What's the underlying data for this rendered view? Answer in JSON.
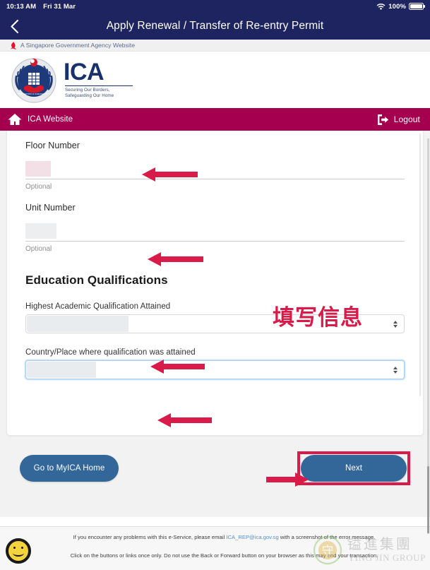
{
  "status_bar": {
    "time": "10:13 AM",
    "date": "Fri 31 Mar",
    "battery_percent": "100%",
    "wifi_icon": "wifi-icon",
    "battery_icon": "battery-full-icon"
  },
  "app_bar": {
    "back_icon": "chevron-left-icon",
    "title": "Apply Renewal / Transfer of Re-entry Permit"
  },
  "gov_banner": {
    "flag_icon": "singapore-flag-icon",
    "text": "A Singapore Government Agency Website"
  },
  "branding": {
    "crest_icon": "ica-crest-icon",
    "acronym": "ICA",
    "tagline_line1": "Securing Our Borders,",
    "tagline_line2": "Safeguarding Our Home"
  },
  "maroon_bar": {
    "home_icon": "home-icon",
    "home_label": "ICA Website",
    "logout_icon": "logout-icon",
    "logout_label": "Logout",
    "color": "#a5004f"
  },
  "form": {
    "floor_number": {
      "label": "Floor Number",
      "value": "",
      "help": "Optional"
    },
    "unit_number": {
      "label": "Unit Number",
      "value": "",
      "help": "Optional"
    },
    "section_title": "Education Qualifications",
    "highest_qualification": {
      "label": "Highest Academic Qualification Attained",
      "value": "",
      "stepper_icon": "select-stepper-icon"
    },
    "country_of_qualification": {
      "label": "Country/Place where qualification was attained",
      "value": "",
      "stepper_icon": "select-stepper-icon"
    }
  },
  "buttons": {
    "home_label": "Go to MyICA Home",
    "next_label": "Next",
    "color": "#336699"
  },
  "footer": {
    "smiley_icon": "smiley-face-icon",
    "line1_before": "If you encounter any problems with this e-Service, please email ",
    "line1_link": "ICA_REP@ica.gov.sg",
    "line1_after": " with a screenshot of the error message.",
    "line2": "Click on the buttons or links once only. Do not use the Back or Forward button on your browser as this may end your transaction."
  },
  "annotations": {
    "chinese_note": "填写信息",
    "arrow_color": "#d81b48",
    "highlight_color": "#d81b48"
  },
  "watermark": {
    "seal_icon": "seal-icon",
    "chinese": "镒進集團",
    "english": "YING JIN GROUP"
  }
}
